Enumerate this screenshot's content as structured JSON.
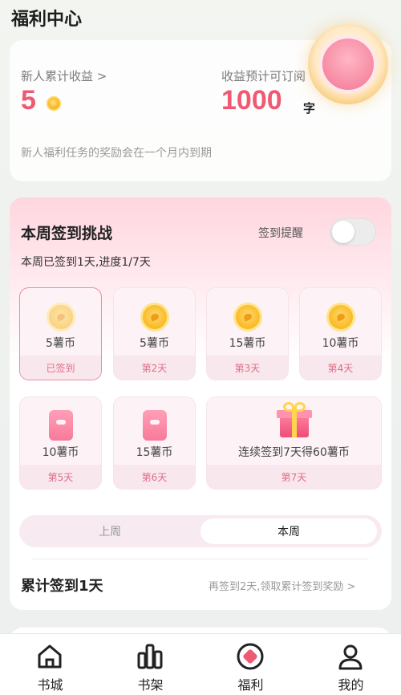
{
  "header": {
    "title": "福利中心"
  },
  "earnings": {
    "left_label": "新人累计收益 >",
    "left_value": "5",
    "right_label": "收益预计可订阅",
    "right_value": "1000",
    "right_unit": "字",
    "note": "新人福利任务的奖励会在一个月内到期"
  },
  "challenge": {
    "title": "本周签到挑战",
    "reminder_label": "签到提醒",
    "reminder_on": false,
    "progress_text": "本周已签到1天,进度1/7天",
    "days": [
      {
        "reward": "5薯币",
        "status": "已签到",
        "icon": "coin-icon",
        "checked": true
      },
      {
        "reward": "5薯币",
        "status": "第2天",
        "icon": "coin-icon",
        "checked": false
      },
      {
        "reward": "15薯币",
        "status": "第3天",
        "icon": "coin-icon",
        "checked": false
      },
      {
        "reward": "10薯币",
        "status": "第4天",
        "icon": "coin-icon",
        "checked": false
      },
      {
        "reward": "10薯币",
        "status": "第5天",
        "icon": "red-envelope-icon",
        "checked": false
      },
      {
        "reward": "15薯币",
        "status": "第6天",
        "icon": "red-envelope-icon",
        "checked": false
      },
      {
        "reward": "连续签到7天得60薯币",
        "status": "第7天",
        "icon": "gift-box-icon",
        "checked": false
      }
    ],
    "week_tabs": {
      "last": "上周",
      "this": "本周",
      "selected": "本周"
    },
    "total_label": "累计签到1天",
    "total_hint": "再签到2天,领取累计签到奖励 >"
  },
  "bottom_nav": {
    "items": [
      {
        "label": "书城",
        "icon": "home-icon"
      },
      {
        "label": "书架",
        "icon": "bookshelf-icon"
      },
      {
        "label": "福利",
        "icon": "welfare-icon"
      },
      {
        "label": "我的",
        "icon": "profile-icon"
      }
    ],
    "active": "福利"
  },
  "colors": {
    "accent": "#ef5a73",
    "coin": "#f9bc2b"
  }
}
